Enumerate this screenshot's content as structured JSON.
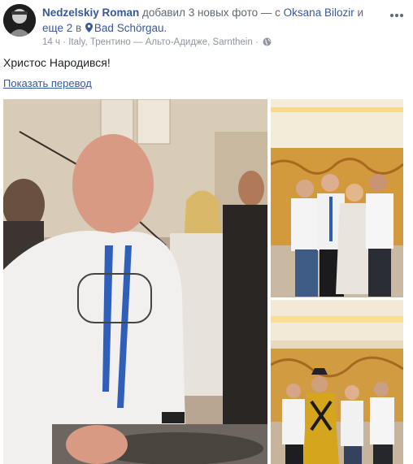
{
  "post": {
    "author": "Nedzelskiy Roman",
    "action_text": " добавил 3 новых фото — с ",
    "tagged_person": "Oksana Bilozir",
    "and_text": " и",
    "others_link": "еще 2",
    "in_text": " в ",
    "location": "Bad Schörgau",
    "end_text": ".",
    "time": "14 ч",
    "separator": " · ",
    "place": "Italy, Трентино — Альто-Адидже, Sarnthein",
    "privacy_icon": "globe-icon",
    "text": "Христос Народився!",
    "translate_link": "Показать перевод"
  },
  "photos": [
    {
      "name": "photo-main"
    },
    {
      "name": "photo-group-top"
    },
    {
      "name": "photo-group-bottom"
    }
  ],
  "colors": {
    "link": "#385898",
    "meta": "#90949c",
    "text": "#1d2129"
  }
}
